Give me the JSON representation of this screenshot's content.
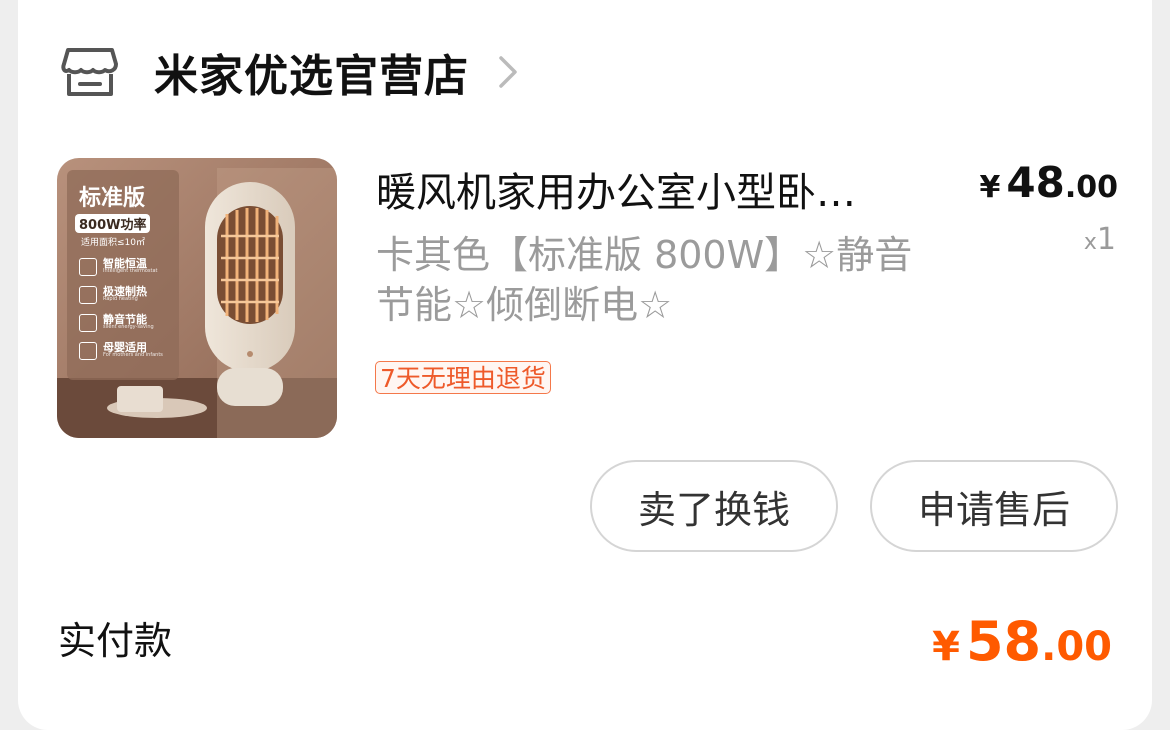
{
  "store": {
    "name": "米家优选官营店",
    "icon": "store-icon",
    "chevron_icon": "chevron-right-icon"
  },
  "product": {
    "title": "暖风机家用办公室小型卧…",
    "price_symbol": "¥",
    "price_integer": "48",
    "price_decimal": ".00",
    "quantity_prefix": "x",
    "quantity": "1",
    "spec": "卡其色【标准版 800W】☆静音节能☆倾倒断电☆",
    "return_badge": "7天无理由退货",
    "image": {
      "version_label": "标准版",
      "power_label": "800W功率",
      "area_label": "适用面积≤10㎡",
      "features": [
        {
          "name": "智能恒温",
          "sub": "Intelligent thermostat"
        },
        {
          "name": "极速制热",
          "sub": "Rapid heating"
        },
        {
          "name": "静音节能",
          "sub": "silent energy-saving"
        },
        {
          "name": "母婴适用",
          "sub": "For mothers and infants"
        }
      ]
    }
  },
  "actions": {
    "sell": "卖了换钱",
    "after_sale": "申请售后"
  },
  "payment": {
    "label": "实付款",
    "symbol": "¥",
    "integer": "58",
    "decimal": ".00"
  },
  "colors": {
    "accent": "#ff5a00",
    "badge_border": "#f4784a",
    "muted_text": "#9b9b9b"
  }
}
